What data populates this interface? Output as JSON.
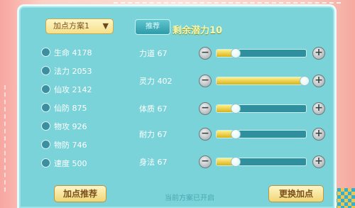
{
  "colors": {
    "panel": "#79d3d9",
    "track": "#2f8f9c",
    "fill": "#e6c62a",
    "button_yellow": "#f6e08a"
  },
  "header": {
    "dropdown_label": "加点方案1",
    "dropdown_icon": "chevron-down-icon",
    "tab_label": "推荐",
    "remaining_points": "剩余潜力10"
  },
  "stats": [
    {
      "icon": "life-icon",
      "text": "生命 4178"
    },
    {
      "icon": "mana-icon",
      "text": "法力 2053"
    },
    {
      "icon": "immortal-attack-icon",
      "text": "仙攻 2142"
    },
    {
      "icon": "immortal-defense-icon",
      "text": "仙防 875"
    },
    {
      "icon": "physical-attack-icon",
      "text": "物攻 926"
    },
    {
      "icon": "physical-defense-icon",
      "text": "物防 746"
    },
    {
      "icon": "speed-icon",
      "text": "速度 500"
    }
  ],
  "attributes": [
    {
      "label": "力道 67",
      "fill_fraction": 0.22
    },
    {
      "label": "灵力 402",
      "fill_fraction": 1.0
    },
    {
      "label": "体质 67",
      "fill_fraction": 0.22
    },
    {
      "label": "耐力 67",
      "fill_fraction": 0.22
    },
    {
      "label": "身法 67",
      "fill_fraction": 0.22
    }
  ],
  "controls": {
    "minus_symbol": "−",
    "plus_symbol": "+"
  },
  "footer": {
    "left_button": "加点推荐",
    "center_text": "当前方案已开启",
    "right_button": "更换加点"
  }
}
